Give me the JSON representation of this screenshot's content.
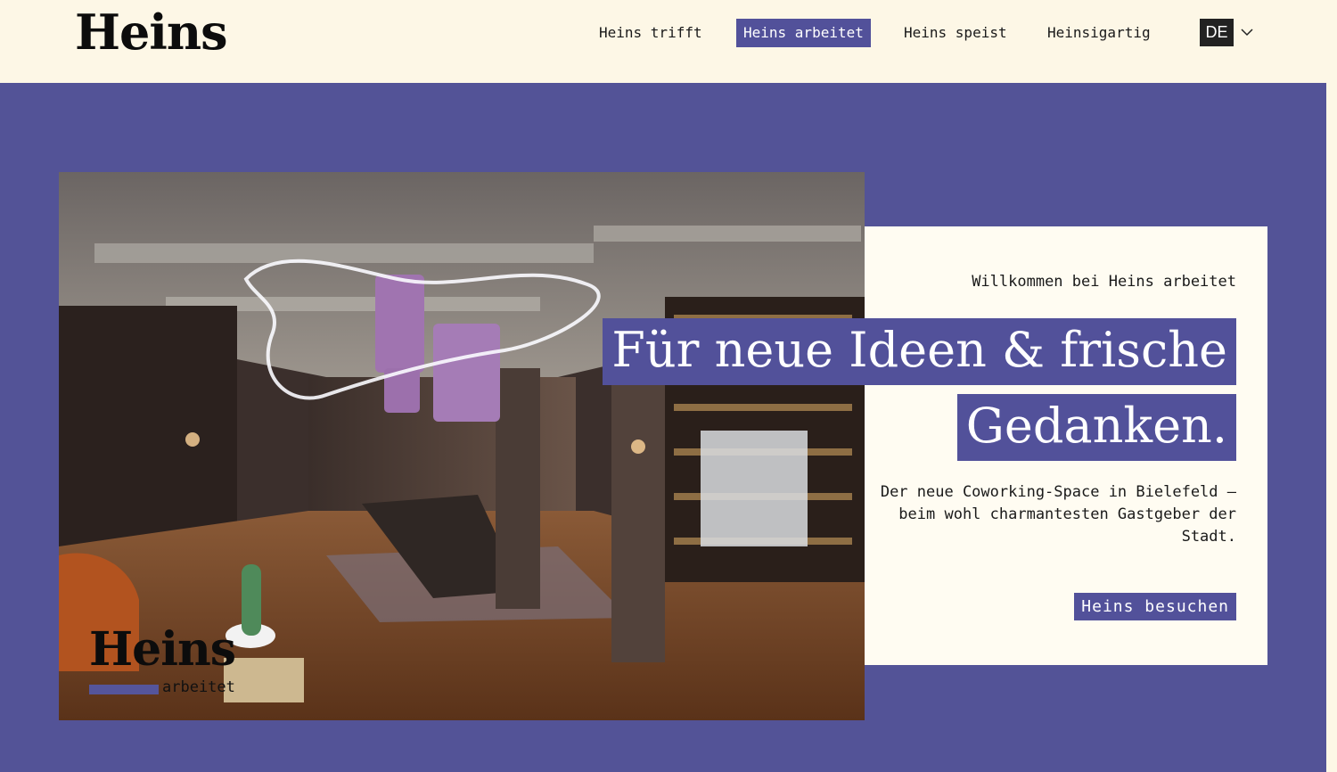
{
  "header": {
    "logo": "Heins",
    "nav": [
      {
        "label": "Heins trifft",
        "active": false
      },
      {
        "label": "Heins arbeitet",
        "active": true
      },
      {
        "label": "Heins speist",
        "active": false
      },
      {
        "label": "Heinsigartig",
        "active": false
      }
    ],
    "language": "DE"
  },
  "hero": {
    "photo_logo": {
      "word": "Heins",
      "sub": "arbeitet"
    },
    "welcome": "Willkommen bei Heins arbeitet",
    "headline_line1": "Für neue Ideen & frische",
    "headline_line2": "Gedanken.",
    "description": "Der neue Coworking-Space in Bielefeld – beim wohl charmantesten Gastgeber der Stadt.",
    "cta_label": "Heins besuchen"
  },
  "colors": {
    "accent": "#52519a",
    "background": "#fdf7e6",
    "card": "#fffcf2"
  }
}
